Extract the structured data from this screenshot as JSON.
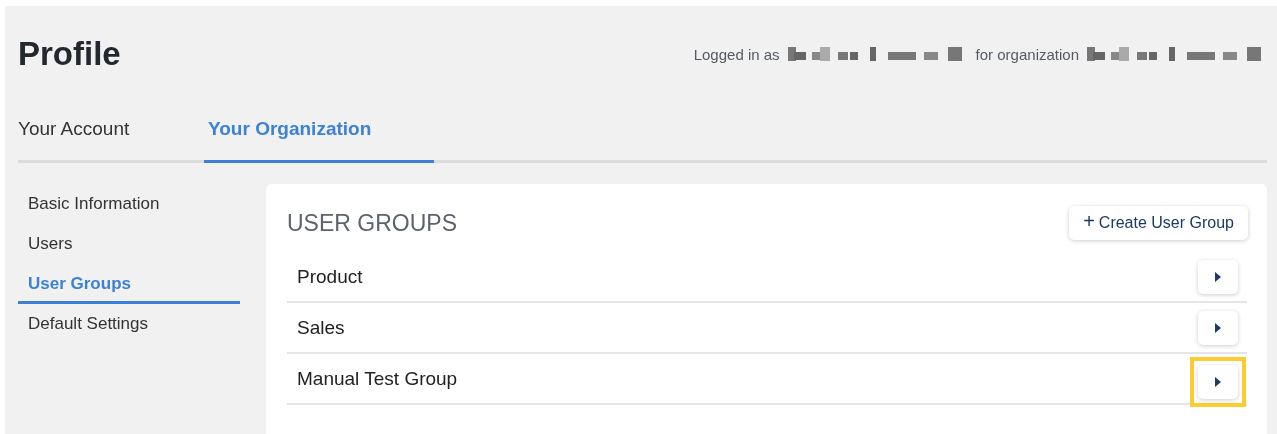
{
  "page": {
    "title": "Profile"
  },
  "login_info": [
    {
      "kind": "text",
      "text": "Logged in as"
    },
    {
      "kind": "redacted"
    },
    {
      "kind": "text",
      "text": "for organization"
    },
    {
      "kind": "redacted"
    }
  ],
  "tabs": [
    {
      "label": "Your Account",
      "selected": false
    },
    {
      "label": "Your Organization",
      "selected": true
    }
  ],
  "sidebar": {
    "items": [
      {
        "label": "Basic Information",
        "selected": false
      },
      {
        "label": "Users",
        "selected": false
      },
      {
        "label": "User Groups",
        "selected": true
      },
      {
        "label": "Default Settings",
        "selected": false
      }
    ]
  },
  "panel": {
    "title": "USER GROUPS",
    "create_button": {
      "icon": "+",
      "label": "Create User Group"
    },
    "rows": [
      {
        "name": "Product",
        "highlighted": false
      },
      {
        "name": "Sales",
        "highlighted": false
      },
      {
        "name": "Manual Test Group",
        "highlighted": true
      }
    ]
  }
}
